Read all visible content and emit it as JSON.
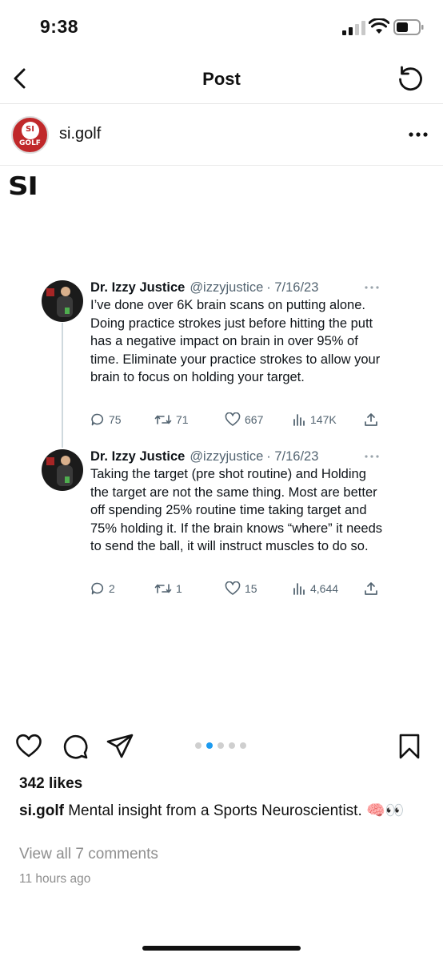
{
  "status_bar": {
    "time": "9:38"
  },
  "nav": {
    "title": "Post",
    "back_icon": "chevron-left-icon",
    "refresh_icon": "refresh-icon"
  },
  "profile": {
    "username": "si.golf",
    "avatar_text_top": "SI",
    "avatar_text_bottom": "GOLF"
  },
  "post_image": {
    "brand_logo": "SI",
    "tweets": [
      {
        "name": "Dr. Izzy Justice",
        "handle": "@izzyjustice",
        "date": "· 7/16/23",
        "text": "I’ve done over 6K brain scans on putting alone. Doing practice strokes just before hitting the putt has a negative impact on brain in over 95% of time.  Eliminate your practice strokes to allow your brain to focus on holding your target.",
        "replies": "75",
        "retweets": "71",
        "likes": "667",
        "views": "147K"
      },
      {
        "name": "Dr. Izzy Justice",
        "handle": "@izzyjustice",
        "date": "· 7/16/23",
        "text": "Taking the target (pre shot routine) and Holding the target are not the same thing. Most are better off spending 25% routine time taking target and 75% holding it. If the brain knows “where” it needs to send the ball, it will instruct muscles to do so.",
        "replies": "2",
        "retweets": "1",
        "likes": "15",
        "views": "4,644"
      }
    ]
  },
  "carousel": {
    "count": 5,
    "active_index": 1,
    "active_color": "#1d9bf0"
  },
  "engagement": {
    "likes": "342 likes",
    "caption_user": "si.golf",
    "caption_text": " Mental insight from a Sports Neuroscientist. 🧠👀",
    "view_comments": "View all 7 comments",
    "time_ago": "11 hours ago"
  },
  "colors": {
    "accent": "#1d9bf0",
    "brand_red": "#c0282a",
    "muted": "#8e8e8e"
  }
}
